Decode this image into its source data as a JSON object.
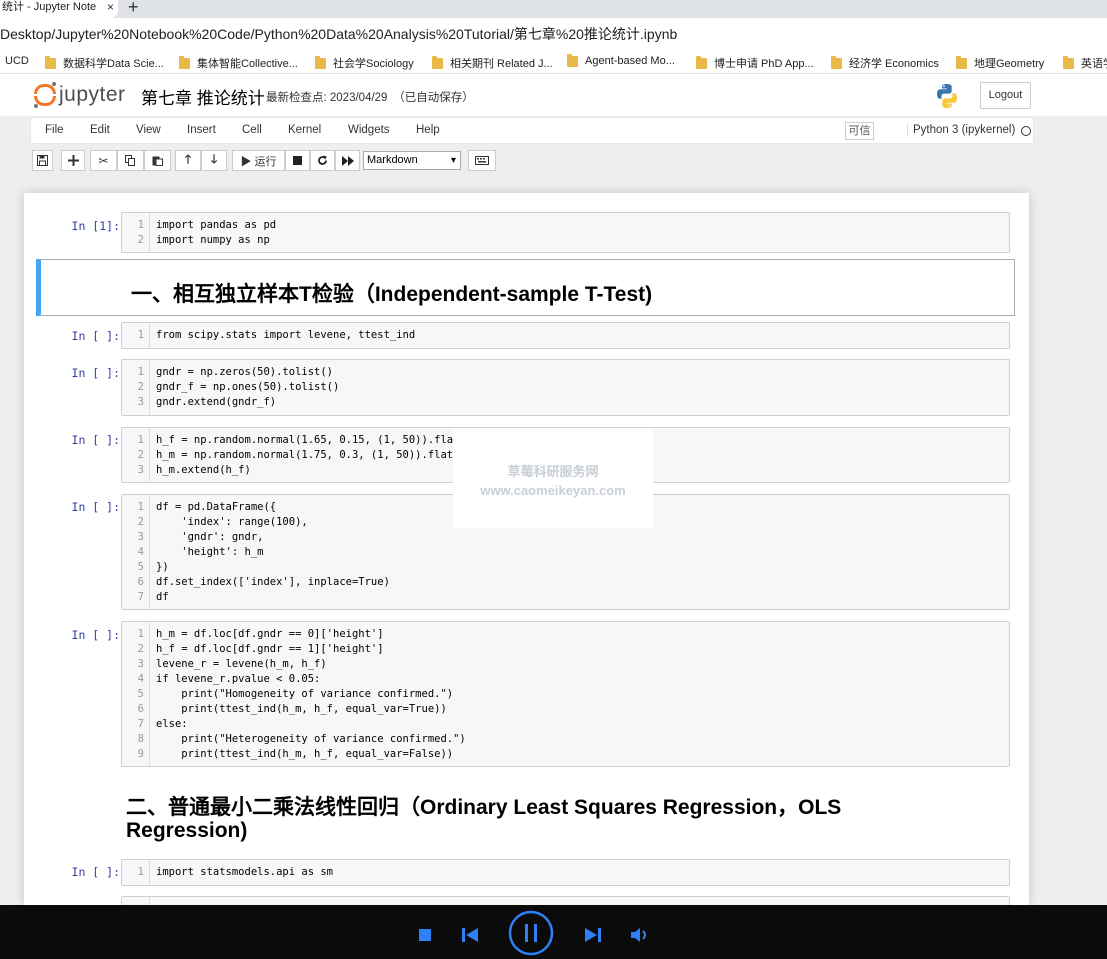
{
  "browser": {
    "tab_title": "统计 - Jupyter Note",
    "tab_close": "×",
    "new_tab": "+",
    "address": "Desktop/Jupyter%20Notebook%20Code/Python%20Data%20Analysis%20Tutorial/第七章%20推论统计.ipynb",
    "bookmarks": [
      {
        "label": "UCD"
      },
      {
        "label": "数据科学Data Scie..."
      },
      {
        "label": "集体智能Collective..."
      },
      {
        "label": "社会学Sociology"
      },
      {
        "label": "相关期刊 Related J..."
      },
      {
        "label": "Agent-based Mo..."
      },
      {
        "label": "博士申请 PhD App..."
      },
      {
        "label": "经济学 Economics"
      },
      {
        "label": "地理Geometry"
      },
      {
        "label": "英语学"
      }
    ]
  },
  "header": {
    "logo_text": "jupyter",
    "notebook_title": "第七章 推论统计",
    "checkpoint": "最新检查点: 2023/04/29　（已自动保存）",
    "logout": "Logout"
  },
  "menu": {
    "items": [
      "File",
      "Edit",
      "View",
      "Insert",
      "Cell",
      "Kernel",
      "Widgets",
      "Help"
    ],
    "trusted": "可信",
    "kernel": "Python 3 (ipykernel)"
  },
  "toolbar": {
    "run_label": "▶ 运行",
    "cell_type": "Markdown"
  },
  "cells": {
    "c1_prompt": "In [1]:",
    "c1": [
      "import pandas as pd",
      "import numpy as np"
    ],
    "h1": "一、相互独立样本T检验（Independent-sample T-Test)",
    "c2_prompt": "In [ ]:",
    "c2": [
      "from scipy.stats import levene, ttest_ind"
    ],
    "c3_prompt": "In [ ]:",
    "c3": [
      "gndr = np.zeros(50).tolist()",
      "gndr_f = np.ones(50).tolist()",
      "gndr.extend(gndr_f)"
    ],
    "c4_prompt": "In [ ]:",
    "c4": [
      "h_f = np.random.normal(1.65, 0.15, (1, 50)).flat",
      "h_m = np.random.normal(1.75, 0.3, (1, 50)).flatt",
      "h_m.extend(h_f)"
    ],
    "c5_prompt": "In [ ]:",
    "c5": [
      "df = pd.DataFrame({",
      "    'index': range(100),",
      "    'gndr': gndr,",
      "    'height': h_m",
      "})",
      "df.set_index(['index'], inplace=True)",
      "df"
    ],
    "c6_prompt": "In [ ]:",
    "c6": [
      "h_m = df.loc[df.gndr == 0]['height']",
      "h_f = df.loc[df.gndr == 1]['height']",
      "levene_r = levene(h_m, h_f)",
      "if levene_r.pvalue < 0.05:",
      "    print(\"Homogeneity of variance confirmed.\")",
      "    print(ttest_ind(h_m, h_f, equal_var=True))",
      "else:",
      "    print(\"Heterogeneity of variance confirmed.\")",
      "    print(ttest_ind(h_m, h_f, equal_var=False))"
    ],
    "h2_line1": "二、普通最小二乘法线性回归（Ordinary Least Squares Regression，OLS",
    "h2_line2": "Regression)",
    "c7_prompt": "In [ ]:",
    "c7": [
      "import statsmodels.api as sm"
    ]
  },
  "watermark": {
    "line1": "草莓科研服务网",
    "line2": "www.caomeikeyan.com"
  }
}
